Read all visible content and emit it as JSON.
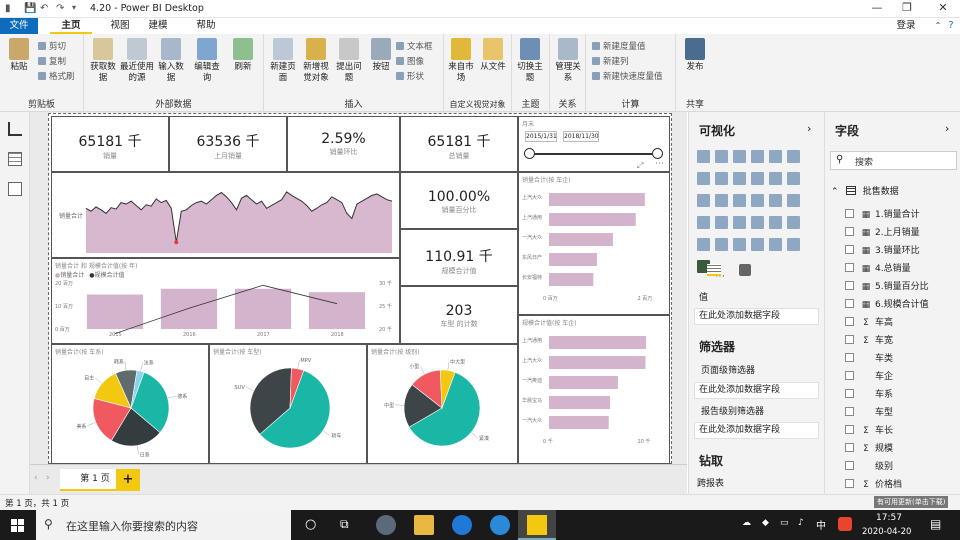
{
  "titlebar": {
    "document_title": "4.20 - Power BI Desktop"
  },
  "menubar": {
    "file": "文件",
    "home": "主页",
    "view": "视图",
    "modeling": "建模",
    "help": "帮助",
    "login": "登录"
  },
  "ribbon": {
    "clipboard": {
      "paste": "粘贴",
      "cut": "剪切",
      "copy": "复制",
      "format_painter": "格式刷",
      "label": "剪贴板"
    },
    "external": {
      "get_data": "获取数据",
      "recent": "最近使用的源",
      "enter": "输入数据",
      "edit_query": "编辑查询",
      "refresh": "刷新",
      "label": "外部数据"
    },
    "insert": {
      "new_page": "新建页面",
      "new_visual": "新增视觉对象",
      "ask": "提出问题",
      "button": "按钮",
      "textbox": "文本框",
      "image": "图像",
      "shapes": "形状",
      "label": "插入"
    },
    "custom_visuals": {
      "from_market": "来自市场",
      "from_file": "从文件",
      "label": "自定义视觉对象"
    },
    "themes": {
      "switch": "切换主题",
      "label": "主题"
    },
    "relations": {
      "manage": "管理关系",
      "label": "关系"
    },
    "calc": {
      "new_measure": "新建度量值",
      "new_column": "新建列",
      "new_quick": "新建快速度量值",
      "label": "计算"
    },
    "share": {
      "publish": "发布",
      "label": "共享"
    }
  },
  "report": {
    "cards": [
      {
        "value": "65181 千",
        "label": "销量"
      },
      {
        "value": "63536 千",
        "label": "上月销量"
      },
      {
        "value": "2.59%",
        "label": "销量环比"
      },
      {
        "value": "65181 千",
        "label": "总销量"
      },
      {
        "value": "100.00%",
        "label": "销量百分比"
      },
      {
        "value": "110.91 千",
        "label": "规模合计值"
      },
      {
        "value": "203",
        "label": "车型 的计数"
      }
    ],
    "slicer": {
      "title": "月末",
      "start": "2015/1/31",
      "end": "2018/11/30"
    },
    "bar_titles": {
      "top": "销量合计(按 车企)",
      "bottom": "规模合计值(按 车企)"
    },
    "top_bar_axis": [
      "0 百万",
      "2 百万"
    ],
    "bottom_bar_axis": [
      "0 千",
      "10 千"
    ],
    "combo": {
      "title": "销量合计 和 规模合计值(按 年)",
      "legend": [
        "销量合计",
        "规模合计值"
      ],
      "left_ticks": [
        "20 百万",
        "10 百万",
        "0 百万"
      ],
      "right_ticks": [
        "30 千",
        "25 千",
        "20 千"
      ]
    },
    "pie_titles": [
      "销量合计(按 车系)",
      "销量合计(按 车型)",
      "销量合计(按 级别)"
    ],
    "line_ylabel": "销量合计"
  },
  "chart_data": [
    {
      "type": "bar",
      "title": "销量合计(按 车企)",
      "categories": [
        "上汽大众",
        "上汽通用",
        "一汽大众",
        "东风日产",
        "长安福特"
      ],
      "values": [
        2.1,
        1.9,
        1.4,
        1.05,
        0.97
      ],
      "xlabel": "",
      "ylabel": "",
      "xlim": [
        0,
        2.3
      ]
    },
    {
      "type": "bar",
      "title": "规模合计值(按 车企)",
      "categories": [
        "上汽通用",
        "上汽大众",
        "一汽奥迪",
        "华晨宝马",
        "一汽大众"
      ],
      "values": [
        14.8,
        14.7,
        10.5,
        9.3,
        9.1
      ],
      "xlabel": "",
      "ylabel": "",
      "xlim": [
        0,
        16
      ]
    },
    {
      "type": "bar",
      "title": "销量合计 和 规模合计值(按 年)",
      "categories": [
        "2015",
        "2016",
        "2017",
        "2018"
      ],
      "series": [
        {
          "name": "销量合计",
          "type": "bar",
          "values": [
            15,
            17.5,
            17.5,
            16
          ]
        },
        {
          "name": "规模合计值",
          "type": "line",
          "values": [
            19,
            24.5,
            29.5,
            25.5
          ]
        }
      ],
      "ylim": [
        0,
        20
      ],
      "ylim_right": [
        20,
        30
      ]
    },
    {
      "type": "line",
      "y": [
        0.62,
        0.58,
        0.64,
        0.6,
        0.55,
        0.63,
        0.61,
        0.7,
        0.68,
        0.72,
        0.66,
        0.6,
        0.67,
        0.65,
        0.75,
        0.7,
        0.73,
        0.62,
        0.15,
        0.58,
        0.6,
        0.66,
        0.7,
        0.72,
        0.68,
        0.74,
        0.8,
        0.84,
        0.78,
        0.7,
        0.6,
        0.76,
        0.8,
        0.74,
        0.68,
        0.72,
        0.62,
        0.66,
        0.7,
        0.74,
        0.85,
        0.8,
        0.76,
        0.72,
        0.66,
        0.58,
        0.62,
        0.67,
        0.7,
        0.78,
        0.74,
        0.7,
        0.55,
        0.48,
        0.68,
        0.72,
        0.76,
        0.8,
        0.82,
        0.78,
        0.74,
        0.72
      ],
      "ylabel": "销量合计",
      "xlabel": ""
    },
    {
      "type": "pie",
      "title": "销量合计(按 车系)",
      "labels": [
        "德系",
        "日系",
        "美系",
        "自主",
        "韩系",
        "法系"
      ],
      "values": [
        30,
        22,
        20,
        14,
        9,
        3
      ],
      "colors": [
        "#1ab7a7",
        "#333d40",
        "#f0595f",
        "#f2c811",
        "#5f6b6d",
        "#8ad4eb"
      ]
    },
    {
      "type": "pie",
      "title": "销量合计(按 车型)",
      "labels": [
        "轿车",
        "SUV",
        "MPV"
      ],
      "values": [
        58,
        37,
        5
      ],
      "colors": [
        "#1ab7a7",
        "#3d4548",
        "#f0595f"
      ]
    },
    {
      "type": "pie",
      "title": "销量合计(按 级别)",
      "labels": [
        "紧凑",
        "中型",
        "小型",
        "中大型"
      ],
      "values": [
        58,
        18,
        13,
        6
      ],
      "colors": [
        "#1ab7a7",
        "#3d4548",
        "#f0595f",
        "#f2c811"
      ]
    }
  ],
  "viz_pane": {
    "title": "可视化",
    "values_label": "值",
    "add_field": "在此处添加数据字段",
    "filters": "筛选器",
    "page_filter": "页面级筛选器",
    "add_page_filter": "在此处添加数据字段",
    "report_filter": "报告级别筛选器",
    "add_report_filter": "在此处添加数据字段",
    "drill": "钻取",
    "cross_report": "跨报表"
  },
  "fields_pane": {
    "title": "字段",
    "search_placeholder": "搜索",
    "table": "批售数据",
    "fields": [
      [
        "calc",
        "1.销量合计"
      ],
      [
        "calc",
        "2.上月销量"
      ],
      [
        "calc",
        "3.销量环比"
      ],
      [
        "calc",
        "4.总销量"
      ],
      [
        "calc",
        "5.销量百分比"
      ],
      [
        "calc",
        "6.规模合计值"
      ],
      [
        "sum",
        "车高"
      ],
      [
        "sum",
        "车宽"
      ],
      [
        "none",
        "车类"
      ],
      [
        "none",
        "车企"
      ],
      [
        "none",
        "车系"
      ],
      [
        "none",
        "车型"
      ],
      [
        "sum",
        "车长"
      ],
      [
        "sum",
        "规模"
      ],
      [
        "none",
        "级别"
      ],
      [
        "sum",
        "价格档"
      ]
    ]
  },
  "page_tab": "第 1 页",
  "statusbar": {
    "text": "第 1 页，共 1 页",
    "update": "有可用更新(单击下载)"
  },
  "taskbar": {
    "search": "在这里输入你要搜索的内容",
    "time": "17:57",
    "date": "2020-04-20",
    "ime": "中"
  }
}
